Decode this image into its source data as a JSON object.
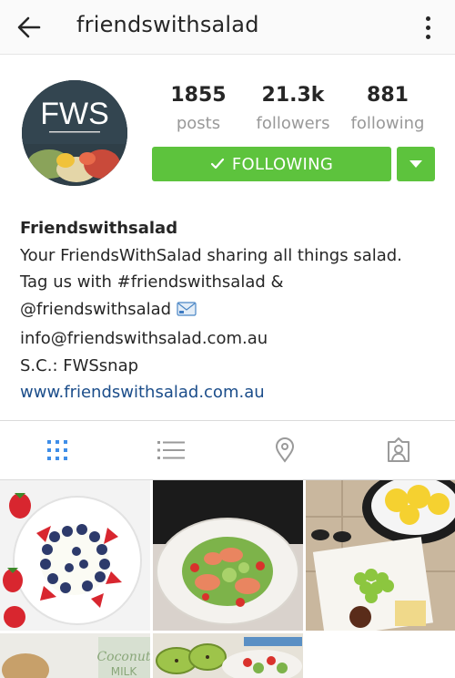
{
  "header": {
    "title": "friendswithsalad",
    "back_icon": "arrow-left-icon",
    "more_icon": "more-vertical-icon"
  },
  "profile": {
    "avatar_text": "FWS",
    "stats": [
      {
        "value": "1855",
        "label": "posts"
      },
      {
        "value": "21.3k",
        "label": "followers"
      },
      {
        "value": "881",
        "label": "following"
      }
    ],
    "follow_button_label": "FOLLOWING",
    "accent_color": "#5dc33d"
  },
  "bio": {
    "name": "Friendswithsalad",
    "lines": [
      "Your FriendsWithSalad sharing all things salad.",
      "Tag us with #friendswithsalad &",
      "@friendswithsalad",
      "info@friendswithsalad.com.au",
      "S.C.: FWSsnap"
    ],
    "website": "www.friendswithsalad.com.au"
  },
  "tabs": [
    {
      "name": "grid-view",
      "icon": "grid-icon",
      "active": true
    },
    {
      "name": "list-view",
      "icon": "list-icon",
      "active": false
    },
    {
      "name": "map-view",
      "icon": "location-pin-icon",
      "active": false
    },
    {
      "name": "tagged-view",
      "icon": "tagged-person-icon",
      "active": false
    }
  ],
  "grid_tiles": [
    {
      "name": "post-yogurt-berries"
    },
    {
      "name": "post-shrimp-salad"
    },
    {
      "name": "post-lemons-grapes"
    },
    {
      "name": "post-coconut-milk"
    },
    {
      "name": "post-kiwi-salad"
    }
  ]
}
